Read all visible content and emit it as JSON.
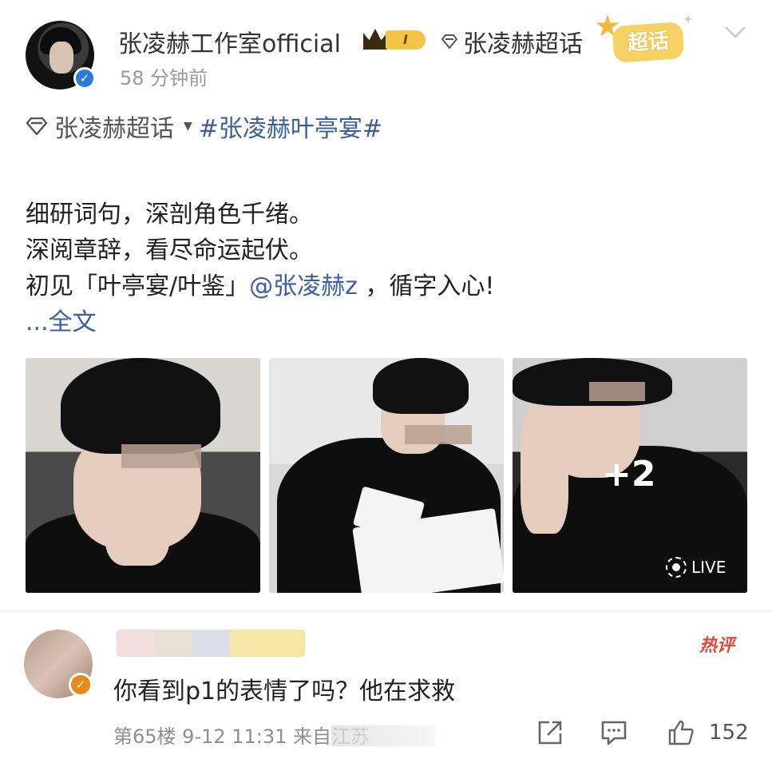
{
  "post": {
    "author_name": "张凌赫工作室official",
    "vip_level": "I",
    "super_topic_label": "张凌赫超话",
    "super_badge_text": "超话",
    "time": "58 分钟前",
    "topic_super": "张凌赫超话",
    "hashtag": "#张凌赫叶亭宴#",
    "body": {
      "line1": "细研词句，深剖角色千绪。",
      "line2": "深阅章辞，看尽命运起伏。",
      "line3_before": "初见「叶亭宴/叶鉴」",
      "mention": "@张凌赫z",
      "line3_after": "，循字入心!",
      "more": "...全文"
    },
    "photos": {
      "extra_count": "+2",
      "live_label": "LIVE"
    }
  },
  "comment": {
    "hot_label": "热评",
    "text": "你看到p1的表情了吗？他在求救",
    "meta": "第65楼 9-12 11:31 来自江苏",
    "like_count": "152"
  },
  "colors": {
    "link_blue": "#3a5f9e",
    "verified_blue": "#2b7bd8",
    "comment_badge_orange": "#e98a16",
    "hot_red": "#e04a3a",
    "vip_gold": "#f3c445"
  },
  "icons": [
    "verified-icon",
    "crown-icon",
    "diamond-icon",
    "chevron-down-icon",
    "live-icon",
    "share-icon",
    "comment-icon",
    "like-icon"
  ]
}
